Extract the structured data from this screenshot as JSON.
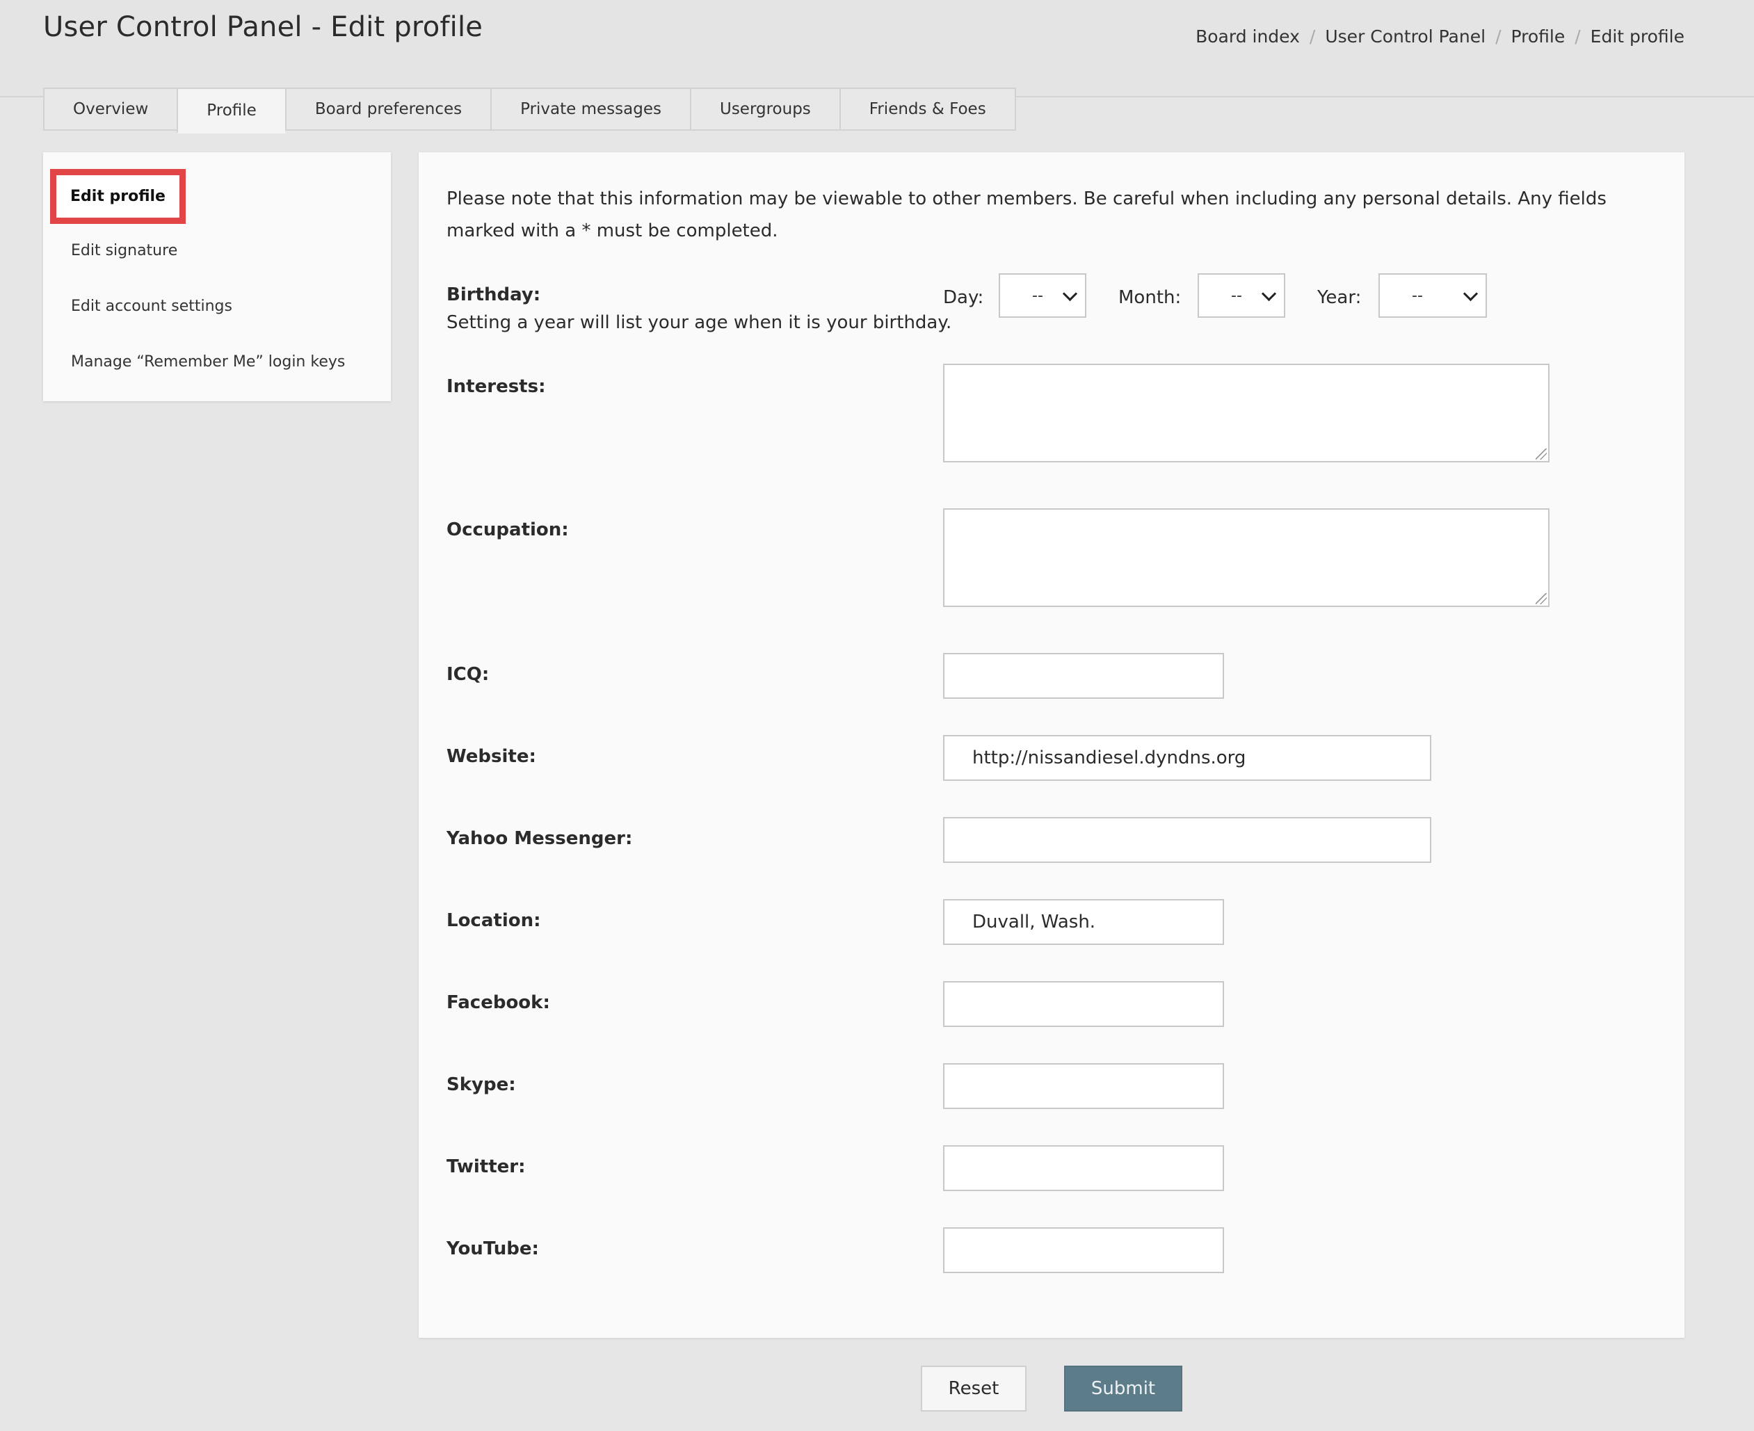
{
  "header": {
    "title": "User Control Panel - Edit profile",
    "breadcrumb": [
      "Board index",
      "User Control Panel",
      "Profile",
      "Edit profile"
    ],
    "breadcrumb_separator": "/"
  },
  "tabs": [
    {
      "label": "Overview",
      "active": false
    },
    {
      "label": "Profile",
      "active": true
    },
    {
      "label": "Board preferences",
      "active": false
    },
    {
      "label": "Private messages",
      "active": false
    },
    {
      "label": "Usergroups",
      "active": false
    },
    {
      "label": "Friends & Foes",
      "active": false
    }
  ],
  "sidebar": {
    "items": [
      {
        "label": "Edit profile",
        "active": true
      },
      {
        "label": "Edit signature",
        "active": false
      },
      {
        "label": "Edit account settings",
        "active": false
      },
      {
        "label": "Manage “Remember Me” login keys",
        "active": false
      }
    ]
  },
  "form": {
    "note": "Please note that this information may be viewable to other members. Be careful when including any personal details. Any fields marked with a * must be completed.",
    "birthday": {
      "label": "Birthday:",
      "hint": "Setting a year will list your age when it is your birthday.",
      "day_label": "Day:",
      "day_value": "--",
      "month_label": "Month:",
      "month_value": "--",
      "year_label": "Year:",
      "year_value": "--"
    },
    "interests": {
      "label": "Interests:",
      "value": ""
    },
    "occupation": {
      "label": "Occupation:",
      "value": ""
    },
    "icq": {
      "label": "ICQ:",
      "value": ""
    },
    "website": {
      "label": "Website:",
      "value": "http://nissandiesel.dyndns.org"
    },
    "yahoo": {
      "label": "Yahoo Messenger:",
      "value": ""
    },
    "location": {
      "label": "Location:",
      "value": "Duvall, Wash."
    },
    "facebook": {
      "label": "Facebook:",
      "value": ""
    },
    "skype": {
      "label": "Skype:",
      "value": ""
    },
    "twitter": {
      "label": "Twitter:",
      "value": ""
    },
    "youtube": {
      "label": "YouTube:",
      "value": ""
    }
  },
  "buttons": {
    "reset": "Reset",
    "submit": "Submit"
  },
  "colors": {
    "highlight_box": "#e24545",
    "submit_bg": "#5d7c8a",
    "page_bg": "#e6e6e6",
    "panel_bg": "#fafafa"
  }
}
